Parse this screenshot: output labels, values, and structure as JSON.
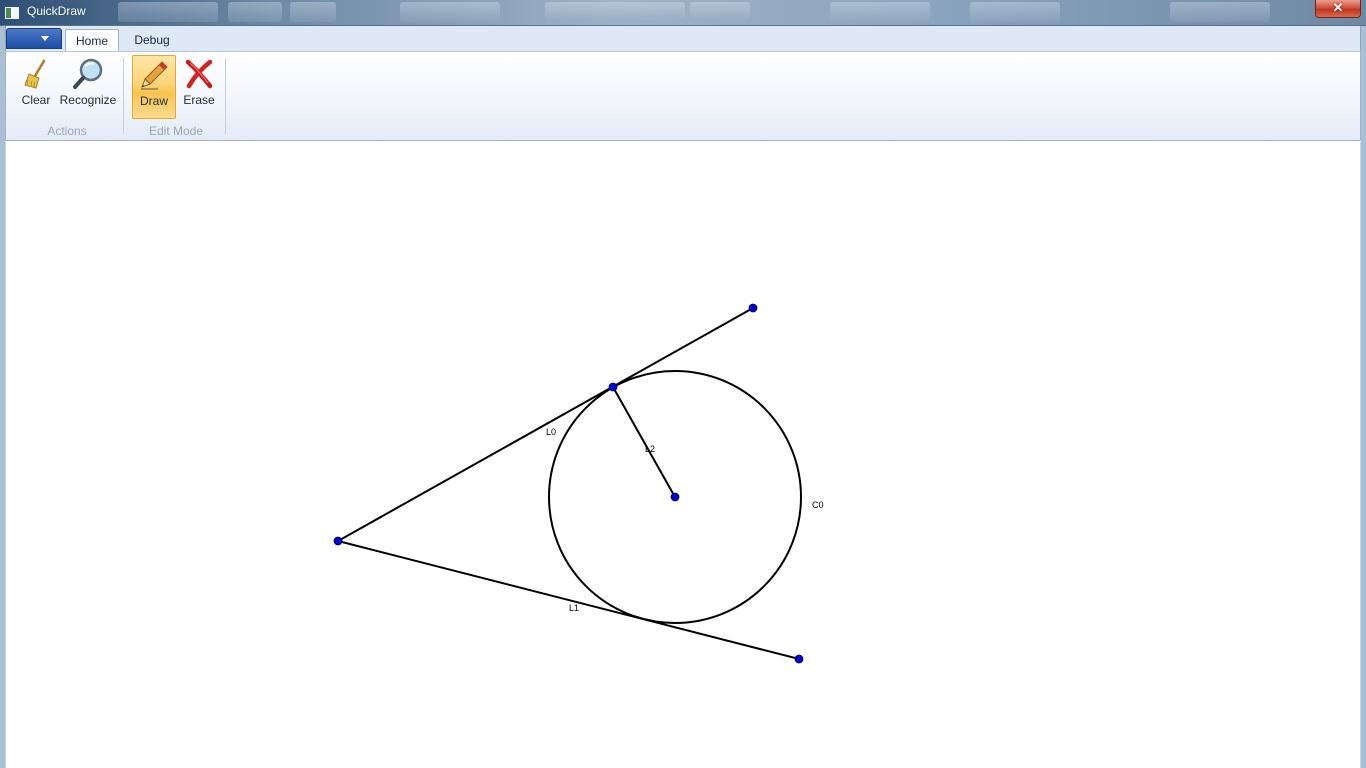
{
  "window": {
    "title": "QuickDraw",
    "close_glyph": "✕"
  },
  "ribbon": {
    "tabs": [
      {
        "label": "Home",
        "selected": true
      },
      {
        "label": "Debug",
        "selected": false
      }
    ],
    "groups": [
      {
        "label": "Actions",
        "buttons": [
          {
            "label": "Clear",
            "icon": "broom-icon"
          },
          {
            "label": "Recognize",
            "icon": "magnifier-icon"
          }
        ]
      },
      {
        "label": "Edit Mode",
        "buttons": [
          {
            "label": "Draw",
            "icon": "pencil-icon",
            "active": true
          },
          {
            "label": "Erase",
            "icon": "red-x-icon",
            "active": false
          }
        ]
      }
    ]
  },
  "canvas": {
    "labels": {
      "l0": "L0",
      "l1": "L1",
      "l2": "L2",
      "c0": "C0"
    },
    "colors": {
      "stroke": "#000000",
      "point": "#0000cc",
      "active_button": "#f9c44e"
    }
  }
}
